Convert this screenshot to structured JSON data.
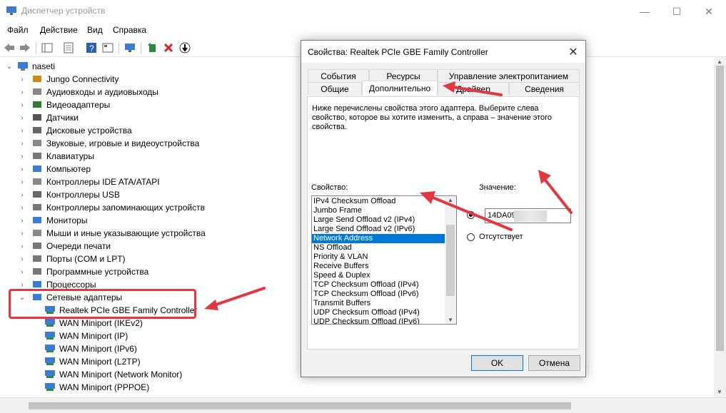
{
  "window": {
    "title": "Диспетчер устройств",
    "controls": {
      "minimize": "—",
      "maximize": "☐",
      "close": "✕"
    }
  },
  "menu": [
    "Файл",
    "Действие",
    "Вид",
    "Справка"
  ],
  "tree": {
    "root": "naseti",
    "categories": [
      "Jungo Connectivity",
      "Аудиовходы и аудиовыходы",
      "Видеоадаптеры",
      "Датчики",
      "Дисковые устройства",
      "Звуковые, игровые и видеоустройства",
      "Клавиатуры",
      "Компьютер",
      "Контроллеры IDE ATA/ATAPI",
      "Контроллеры USB",
      "Контроллеры запоминающих устройств",
      "Мониторы",
      "Мыши и иные указывающие устройства",
      "Очереди печати",
      "Порты (COM и LPT)",
      "Программные устройства",
      "Процессоры",
      "Сетевые адаптеры"
    ],
    "network_children": [
      "Realtek PCIe GBE Family Controller",
      "WAN Miniport (IKEv2)",
      "WAN Miniport (IP)",
      "WAN Miniport (IPv6)",
      "WAN Miniport (L2TP)",
      "WAN Miniport (Network Monitor)",
      "WAN Miniport (PPPOE)"
    ]
  },
  "dialog": {
    "title": "Свойства: Realtek PCIe GBE Family Controller",
    "close": "✕",
    "tabs_top": [
      "События",
      "Ресурсы",
      "Управление электропитанием"
    ],
    "tabs_bottom": [
      "Общие",
      "Дополнительно",
      "Драйвер",
      "Сведения"
    ],
    "description": "Ниже перечислены свойства этого адаптера. Выберите слева свойство, которое вы хотите изменить, а справа – значение этого свойства.",
    "property_label": "Свойство:",
    "value_label": "Значение:",
    "properties": [
      "IPv4 Checksum Offload",
      "Jumbo Frame",
      "Large Send Offload v2 (IPv4)",
      "Large Send Offload v2 (IPv6)",
      "Network Address",
      "NS Offload",
      "Priority & VLAN",
      "Receive Buffers",
      "Speed & Duplex",
      "TCP Checksum Offload (IPv4)",
      "TCP Checksum Offload (IPv6)",
      "Transmit Buffers",
      "UDP Checksum Offload (IPv4)",
      "UDP Checksum Offload (IPv6)"
    ],
    "selected_property": "Network Address",
    "value": "14DA09",
    "absent_label": "Отсутствует",
    "ok": "OK",
    "cancel": "Отмена"
  },
  "colors": {
    "accent": "#0078d7",
    "annotation": "#e0383e"
  }
}
